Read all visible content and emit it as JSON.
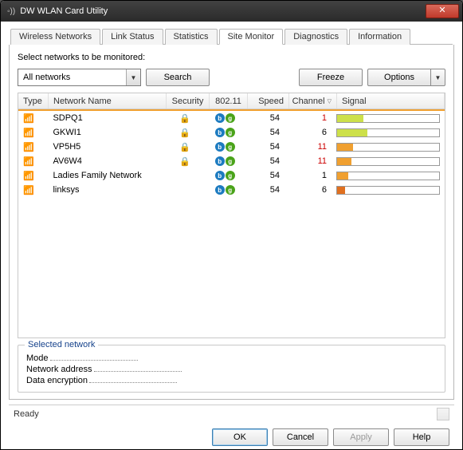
{
  "title": "DW WLAN Card Utility",
  "tabs": [
    "Wireless Networks",
    "Link Status",
    "Statistics",
    "Site Monitor",
    "Diagnostics",
    "Information"
  ],
  "active_tab": 3,
  "select_label": "Select networks to be monitored:",
  "dropdown_value": "All networks",
  "buttons": {
    "search": "Search",
    "freeze": "Freeze",
    "options": "Options"
  },
  "columns": {
    "type": "Type",
    "name": "Network Name",
    "sec": "Security",
    "p802": "802.11",
    "speed": "Speed",
    "channel": "Channel",
    "signal": "Signal"
  },
  "rows": [
    {
      "name": "SDPQ1",
      "secured": true,
      "speed": "54",
      "channel": "1",
      "ch_color": "#c00",
      "sig_pct": 26,
      "sig_color": "#cde04a"
    },
    {
      "name": "GKWI1",
      "secured": true,
      "speed": "54",
      "channel": "6",
      "ch_color": "#000",
      "sig_pct": 30,
      "sig_color": "#cde04a"
    },
    {
      "name": "VP5H5",
      "secured": true,
      "speed": "54",
      "channel": "11",
      "ch_color": "#c00",
      "sig_pct": 16,
      "sig_color": "#f0a030"
    },
    {
      "name": "AV6W4",
      "secured": true,
      "speed": "54",
      "channel": "11",
      "ch_color": "#c00",
      "sig_pct": 14,
      "sig_color": "#f0a030"
    },
    {
      "name": "Ladies Family Network",
      "secured": false,
      "speed": "54",
      "channel": "1",
      "ch_color": "#000",
      "sig_pct": 11,
      "sig_color": "#f0a030"
    },
    {
      "name": "linksys",
      "secured": false,
      "speed": "54",
      "channel": "6",
      "ch_color": "#000",
      "sig_pct": 8,
      "sig_color": "#e07020"
    }
  ],
  "selected": {
    "legend": "Selected network",
    "mode": "Mode",
    "addr": "Network address",
    "enc": "Data encryption"
  },
  "status": "Ready",
  "footer": {
    "ok": "OK",
    "cancel": "Cancel",
    "apply": "Apply",
    "help": "Help"
  }
}
